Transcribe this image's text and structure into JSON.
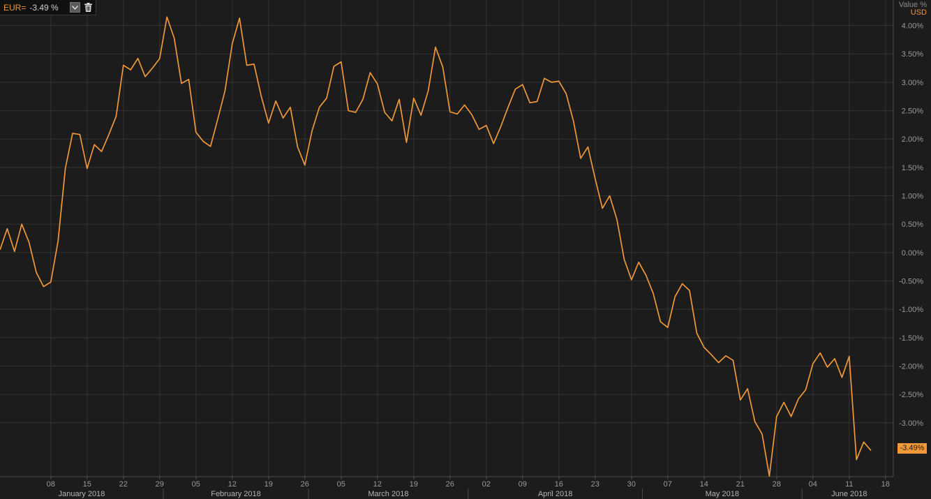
{
  "legend": {
    "ric": "EUR=",
    "value": "-3.49 %"
  },
  "axis_header": {
    "value_label": "Value %",
    "unit_label": "USD"
  },
  "last_value_tag": "-3.49%",
  "colors": {
    "background": "#1c1c1c",
    "grid": "#333333",
    "line": "#f0983a",
    "tick_text": "#9a9a9a",
    "month_text": "#b4b4b4"
  },
  "chart_data": {
    "type": "line",
    "title": "",
    "xlabel": "",
    "ylabel": "Value %",
    "ylim": [
      -3.95,
      4.45
    ],
    "grid": true,
    "y_ticks": [
      "4.00%",
      "3.50%",
      "3.00%",
      "2.50%",
      "2.00%",
      "1.50%",
      "1.00%",
      "0.50%",
      "0.00%",
      "-0.50%",
      "-1.00%",
      "-1.50%",
      "-2.00%",
      "-2.50%",
      "-3.00%"
    ],
    "y_tick_values": [
      4.0,
      3.5,
      3.0,
      2.5,
      2.0,
      1.5,
      1.0,
      0.5,
      0.0,
      -0.5,
      -1.0,
      -1.5,
      -2.0,
      -2.5,
      -3.0
    ],
    "x_tick_labels": [
      "08",
      "15",
      "22",
      "29",
      "05",
      "12",
      "19",
      "26",
      "05",
      "12",
      "19",
      "26",
      "02",
      "09",
      "16",
      "23",
      "30",
      "07",
      "14",
      "21",
      "28",
      "04",
      "11",
      "18"
    ],
    "x_tick_index": [
      7,
      12,
      17,
      22,
      27,
      32,
      37,
      42,
      47,
      52,
      57,
      62,
      67,
      72,
      77,
      82,
      87,
      92,
      97,
      102,
      107,
      112,
      117,
      122
    ],
    "months": [
      {
        "label": "January 2018",
        "start": 0,
        "end": 22.5
      },
      {
        "label": "February 2018",
        "start": 22.5,
        "end": 42.5
      },
      {
        "label": "March 2018",
        "start": 42.5,
        "end": 64.5
      },
      {
        "label": "April 2018",
        "start": 64.5,
        "end": 88.5
      },
      {
        "label": "May 2018",
        "start": 88.5,
        "end": 110.5
      },
      {
        "label": "June 2018",
        "start": 110.5,
        "end": 123.5
      }
    ],
    "series": [
      {
        "values": [
          0.05,
          0.42,
          0.02,
          0.5,
          0.18,
          -0.35,
          -0.6,
          -0.52,
          0.2,
          1.48,
          2.1,
          2.08,
          1.48,
          1.9,
          1.78,
          2.08,
          2.4,
          3.3,
          3.22,
          3.42,
          3.1,
          3.25,
          3.42,
          4.15,
          3.78,
          2.98,
          3.05,
          2.12,
          1.96,
          1.87,
          2.35,
          2.85,
          3.68,
          4.13,
          3.3,
          3.32,
          2.75,
          2.28,
          2.67,
          2.37,
          2.56,
          1.86,
          1.54,
          2.15,
          2.56,
          2.72,
          3.28,
          3.36,
          2.5,
          2.47,
          2.7,
          3.17,
          2.97,
          2.47,
          2.32,
          2.7,
          1.94,
          2.72,
          2.42,
          2.85,
          3.62,
          3.27,
          2.48,
          2.44,
          2.6,
          2.43,
          2.17,
          2.24,
          1.92,
          2.22,
          2.56,
          2.88,
          2.96,
          2.64,
          2.66,
          3.07,
          3.0,
          3.02,
          2.8,
          2.32,
          1.66,
          1.86,
          1.3,
          0.78,
          1.0,
          0.58,
          -0.12,
          -0.48,
          -0.17,
          -0.4,
          -0.72,
          -1.22,
          -1.32,
          -0.78,
          -0.55,
          -0.67,
          -1.42,
          -1.67,
          -1.8,
          -1.94,
          -1.82,
          -1.9,
          -2.6,
          -2.4,
          -2.98,
          -3.2,
          -3.94,
          -2.89,
          -2.64,
          -2.89,
          -2.58,
          -2.42,
          -1.96,
          -1.77,
          -2.02,
          -1.87,
          -2.2,
          -1.83,
          -3.65,
          -3.34,
          -3.49
        ]
      }
    ]
  }
}
